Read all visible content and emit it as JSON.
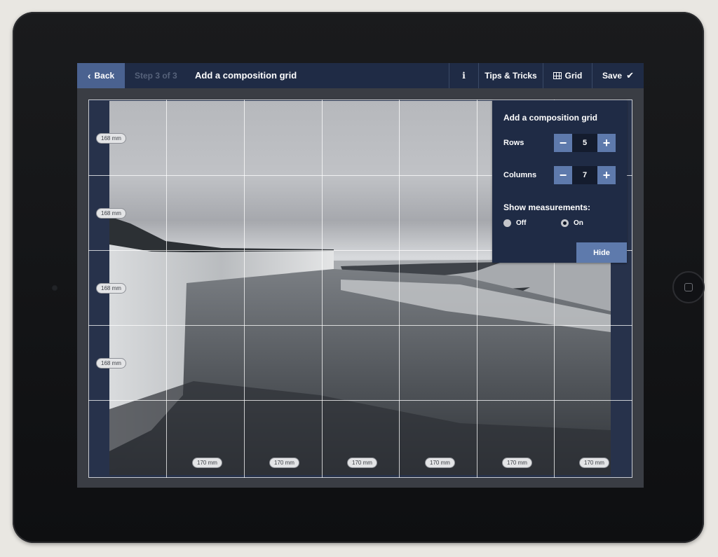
{
  "topbar": {
    "back_label": "Back",
    "back_icon": "chevron-left-icon",
    "step_label": "Step 3 of 3",
    "title": "Add a composition grid",
    "info_label": "i",
    "tips_label": "Tips & Tricks",
    "grid_label": "Grid",
    "grid_icon": "grid-icon",
    "save_label": "Save",
    "save_icon": "checkmark-icon"
  },
  "grid": {
    "rows": 5,
    "columns": 7,
    "row_labels": [
      "168 mm",
      "168 mm",
      "168 mm",
      "168 mm"
    ],
    "column_labels": [
      "170 mm",
      "170 mm",
      "170 mm",
      "170 mm",
      "170 mm",
      "170 mm"
    ]
  },
  "panel": {
    "title": "Add a composition grid",
    "rows_label": "Rows",
    "rows_value": "5",
    "columns_label": "Columns",
    "columns_value": "7",
    "minus_symbol": "−",
    "plus_symbol": "+",
    "measurements_label": "Show measurements:",
    "off_label": "Off",
    "on_label": "On",
    "selected": "On",
    "hide_label": "Hide"
  },
  "colors": {
    "toolbar": "#1f2b45",
    "accent": "#5e7aac",
    "back": "#4a6290"
  }
}
